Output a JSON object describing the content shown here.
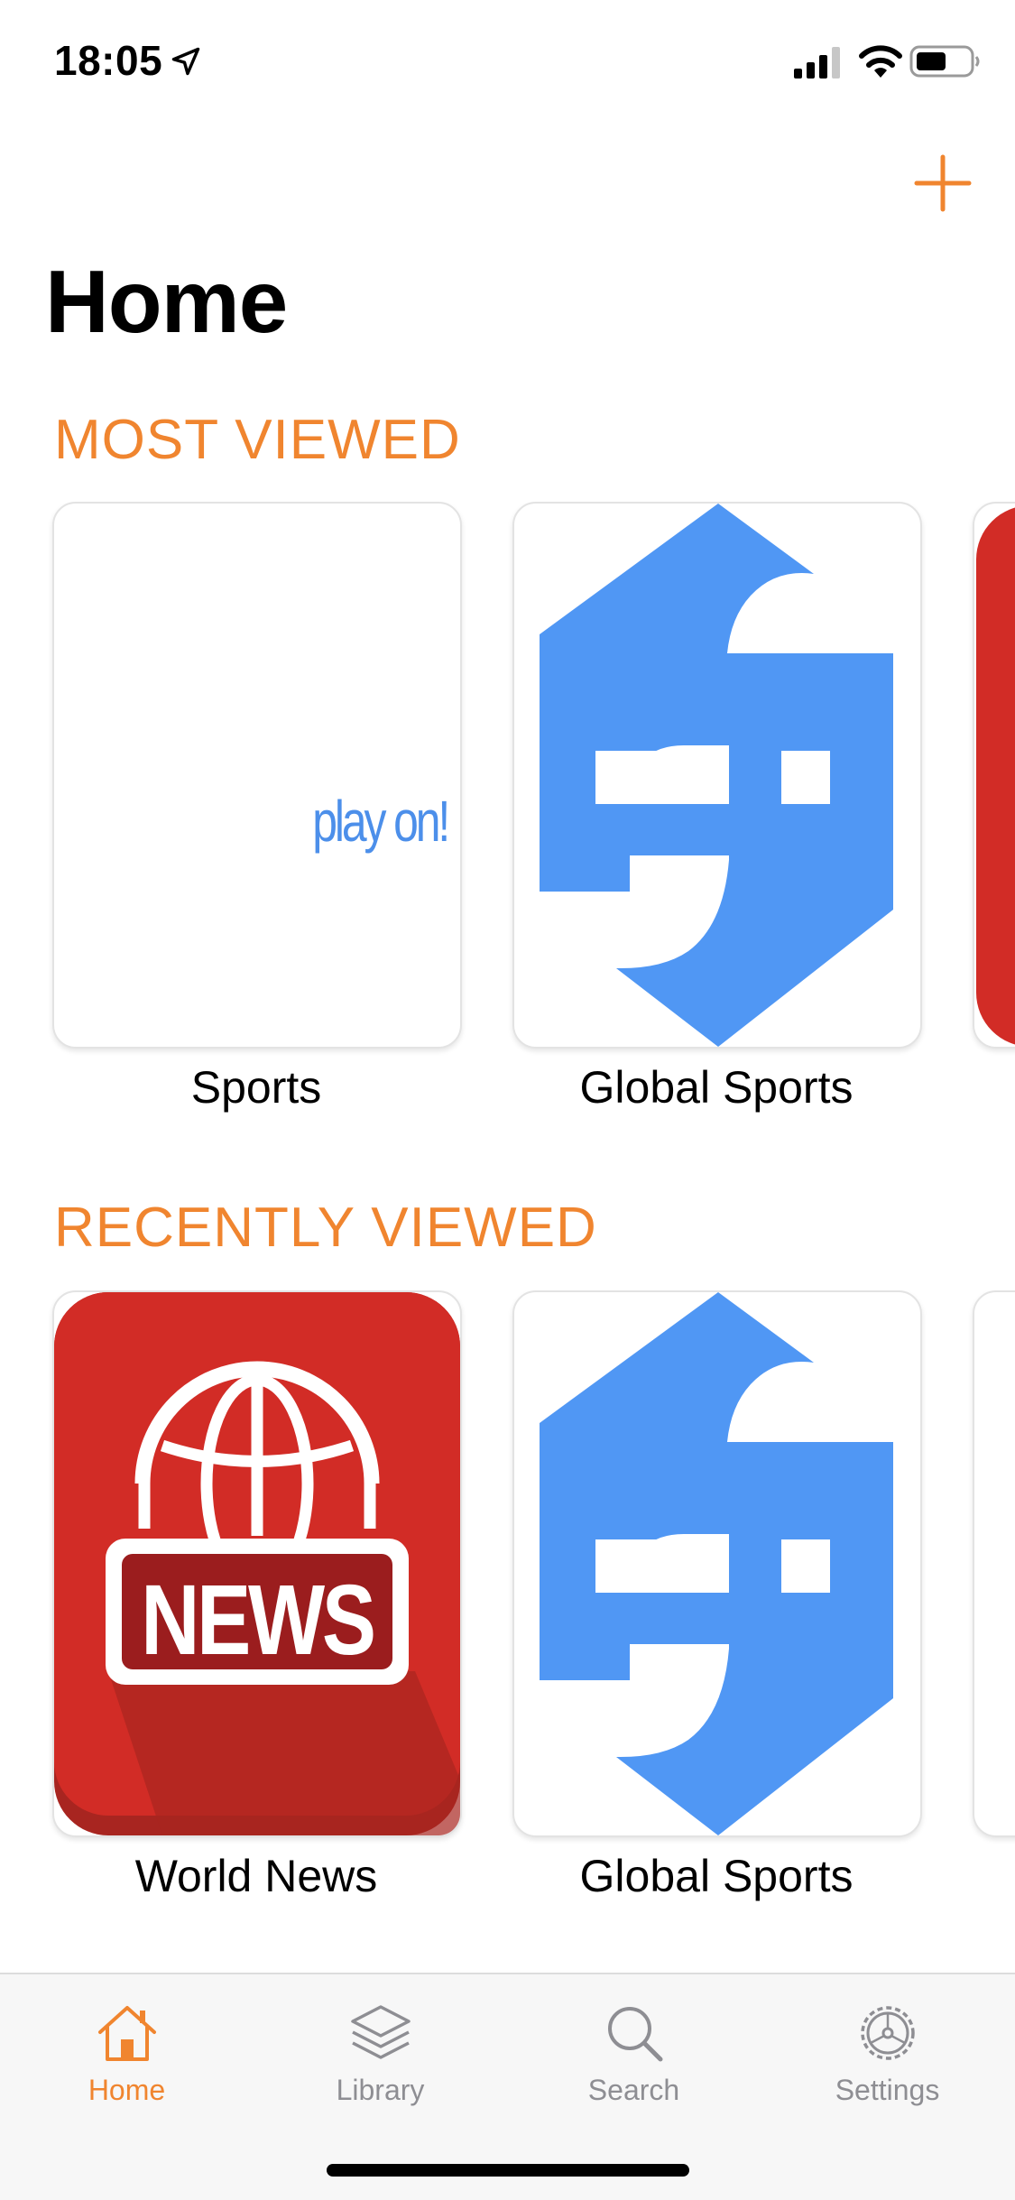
{
  "status_bar": {
    "time": "18:05"
  },
  "header": {
    "title": "Home"
  },
  "sections": {
    "most_viewed": {
      "title": "MOST VIEWED",
      "items": [
        {
          "label": "Sports",
          "logo_text": "play on!"
        },
        {
          "label": "Global Sports"
        }
      ]
    },
    "recently_viewed": {
      "title": "RECENTLY VIEWED",
      "items": [
        {
          "label": "World News",
          "logo_text": "NEWS"
        },
        {
          "label": "Global Sports"
        }
      ]
    }
  },
  "tab_bar": {
    "tabs": [
      {
        "label": "Home",
        "icon": "house-icon",
        "active": true
      },
      {
        "label": "Library",
        "icon": "layers-icon",
        "active": false
      },
      {
        "label": "Search",
        "icon": "search-icon",
        "active": false
      },
      {
        "label": "Settings",
        "icon": "gear-icon",
        "active": false
      }
    ]
  },
  "colors": {
    "accent": "#F0852F",
    "global_sports_blue": "#5097F4",
    "news_red": "#D22C26"
  }
}
